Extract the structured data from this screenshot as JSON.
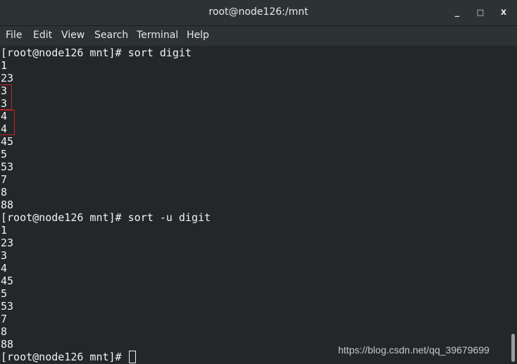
{
  "window": {
    "title": "root@node126:/mnt",
    "minimize": "_",
    "maximize": "□",
    "close": "x"
  },
  "menubar": {
    "items": [
      "File",
      "Edit",
      "View",
      "Search",
      "Terminal",
      "Help"
    ]
  },
  "terminal": {
    "lines": [
      "[root@node126 mnt]# sort digit",
      "1",
      "23",
      "3",
      "3",
      "4",
      "4",
      "45",
      "5",
      "53",
      "7",
      "8",
      "88",
      "[root@node126 mnt]# sort -u digit",
      "1",
      "23",
      "3",
      "4",
      "45",
      "5",
      "53",
      "7",
      "8",
      "88",
      "[root@node126 mnt]# "
    ],
    "highlight_color": "#c0242a"
  },
  "watermark": "https://blog.csdn.net/qq_39679699"
}
